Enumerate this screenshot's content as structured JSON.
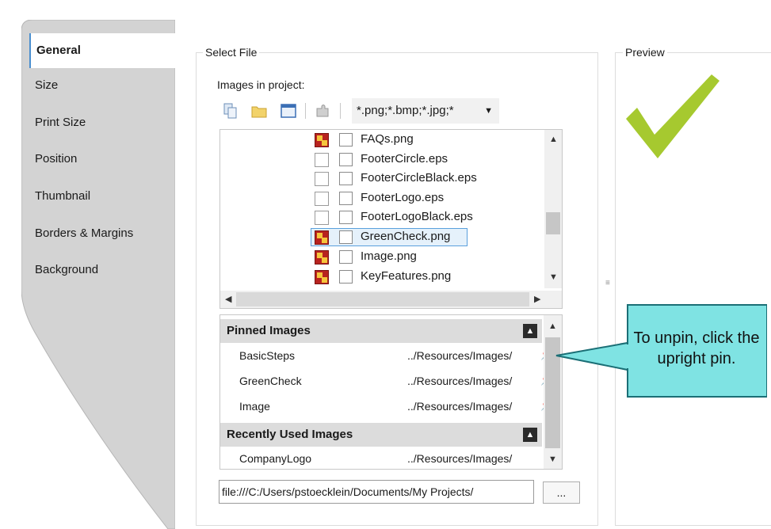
{
  "tabs": [
    {
      "label": "General",
      "active": true
    },
    {
      "label": "Size"
    },
    {
      "label": "Print Size"
    },
    {
      "label": "Position"
    },
    {
      "label": "Thumbnail"
    },
    {
      "label": "Borders & Margins"
    },
    {
      "label": "Background"
    }
  ],
  "select_file": {
    "title": "Select File",
    "images_label": "Images in project:",
    "toolbar": {
      "icons": [
        "copy-icon",
        "open-folder-icon",
        "window-icon",
        "puzzle-icon"
      ],
      "filter_value": "*.png;*.bmp;*.jpg;*"
    },
    "files": [
      {
        "name": "FAQs.png",
        "type": "image"
      },
      {
        "name": "FooterCircle.eps",
        "type": "doc"
      },
      {
        "name": "FooterCircleBlack.eps",
        "type": "doc"
      },
      {
        "name": "FooterLogo.eps",
        "type": "doc"
      },
      {
        "name": "FooterLogoBlack.eps",
        "type": "doc"
      },
      {
        "name": "GreenCheck.png",
        "type": "image",
        "selected": true
      },
      {
        "name": "Image.png",
        "type": "image"
      },
      {
        "name": "KeyFeatures.png",
        "type": "image"
      }
    ],
    "pinned_header": "Pinned Images",
    "pinned": [
      {
        "name": "BasicSteps",
        "path": "../Resources/Images/"
      },
      {
        "name": "GreenCheck",
        "path": "../Resources/Images/"
      },
      {
        "name": "Image",
        "path": "../Resources/Images/"
      }
    ],
    "recent_header": "Recently Used Images",
    "recent": [
      {
        "name": "CompanyLogo",
        "path": "../Resources/Images/"
      }
    ],
    "path_value": "file:///C:/Users/pstoecklein/Documents/My Projects/",
    "browse_label": "..."
  },
  "preview": {
    "title": "Preview",
    "check_color": "#a6c92f"
  },
  "callout": {
    "text": "To unpin, click the upright pin.",
    "color": "#7fe3e3"
  },
  "colors": {
    "tab_strip": "#cfcfcf",
    "selection": "#5aa0dd"
  }
}
